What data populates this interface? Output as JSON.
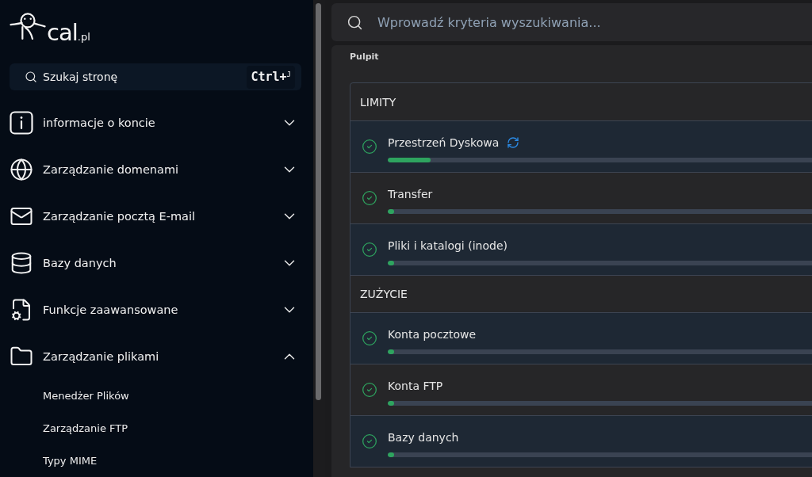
{
  "sidebar": {
    "logo": {
      "name": "cal",
      "suffix": ".pl"
    },
    "page_search": {
      "label": "Szukaj stronę",
      "shortcut": "Ctrl+$^{J}$"
    },
    "items": [
      {
        "label": "informacje o koncie",
        "expanded": false
      },
      {
        "label": "Zarządzanie domenami",
        "expanded": false
      },
      {
        "label": "Zarządzanie pocztą E-mail",
        "expanded": false
      },
      {
        "label": "Bazy danych",
        "expanded": false
      },
      {
        "label": "Funkcje zaawansowane",
        "expanded": false
      },
      {
        "label": "Zarządzanie plikami",
        "expanded": true,
        "children": [
          {
            "label": "Menedżer Plików"
          },
          {
            "label": "Zarządzanie FTP"
          },
          {
            "label": "Typy MIME"
          }
        ]
      }
    ]
  },
  "search": {
    "placeholder": "Wprowadź kryteria wyszukiwania..."
  },
  "breadcrumb": "Pulpit",
  "dashboard": {
    "sections": [
      {
        "title": "LIMITY",
        "rows": [
          {
            "label": "Przestrzeń Dyskowa",
            "ok": true,
            "refreshable": true,
            "level": 0.1
          },
          {
            "label": "Transfer",
            "ok": true,
            "refreshable": false,
            "level": 0.015
          },
          {
            "label": "Pliki i katalogi (inode)",
            "ok": true,
            "refreshable": false,
            "level": 0.015
          }
        ]
      },
      {
        "title": "ZUŻYCIE",
        "rows": [
          {
            "label": "Konta pocztowe",
            "ok": true,
            "refreshable": false,
            "level": 0.015
          },
          {
            "label": "Konta FTP",
            "ok": true,
            "refreshable": false,
            "level": 0.015
          },
          {
            "label": "Bazy danych",
            "ok": true,
            "refreshable": false,
            "level": 0.015
          }
        ]
      }
    ]
  }
}
